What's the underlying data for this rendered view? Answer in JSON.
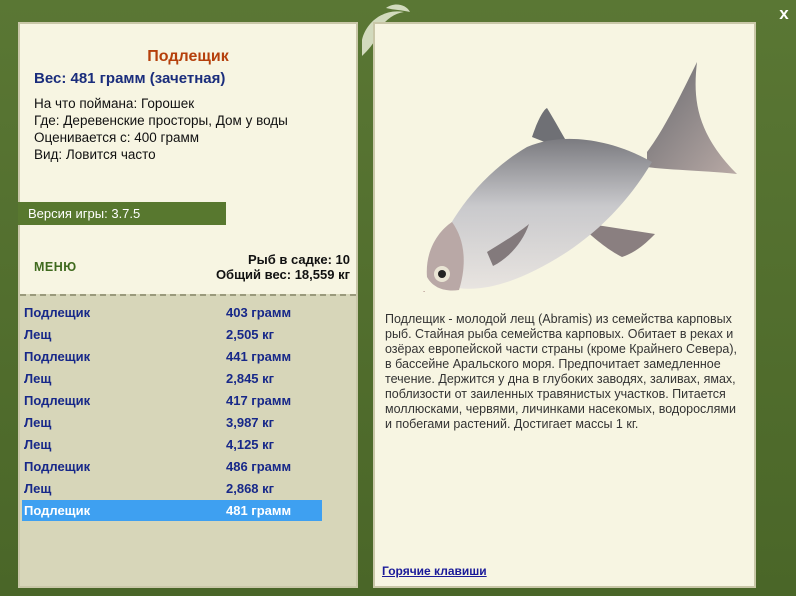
{
  "fish": {
    "name": "Подлещик",
    "weight_line": "Вес: 481 грамм (зачетная)",
    "info": [
      "На что поймана: Горошек",
      "Где: Деревенские просторы, Дом у воды",
      "Оценивается с: 400 грамм",
      "Вид: Ловится часто"
    ],
    "description": "Подлещик - молодой лещ (Abramis) из семейства карповых рыб. Стайная рыба семейства карповых. Обитает в реках и озёрах европейской части страны (кроме Крайнего Севера), в бассейне Аральского моря. Предпочитает замедленное течение. Держится у дна в глубоких заводях, заливах, ямах, поблизости от заиленных травянистых участков. Питается моллюсками, червями, личинками насекомых, водорослями и побегами растений. Достигает массы 1 кг."
  },
  "version": "Версия игры: 3.7.5",
  "menu_label": "МЕНЮ",
  "stats": {
    "count": "Рыб в садке: 10",
    "total": "Общий вес: 18,559 кг"
  },
  "catch_list": [
    {
      "name": "Подлещик",
      "weight": "403 грамм"
    },
    {
      "name": "Лещ",
      "weight": "2,505 кг"
    },
    {
      "name": "Подлещик",
      "weight": "441 грамм"
    },
    {
      "name": "Лещ",
      "weight": "2,845 кг"
    },
    {
      "name": "Подлещик",
      "weight": "417 грамм"
    },
    {
      "name": "Лещ",
      "weight": "3,987 кг"
    },
    {
      "name": "Лещ",
      "weight": "4,125 кг"
    },
    {
      "name": "Подлещик",
      "weight": "486 грамм"
    },
    {
      "name": "Лещ",
      "weight": "2,868 кг"
    },
    {
      "name": "Подлещик",
      "weight": "481 грамм",
      "selected": true
    }
  ],
  "hotkeys_label": "Горячие клавиши",
  "close_label": "x",
  "colors": {
    "frame": "#4f6b2e",
    "panel": "#f7f5e2",
    "selection": "#3ea0f1",
    "title": "#b5400c"
  }
}
